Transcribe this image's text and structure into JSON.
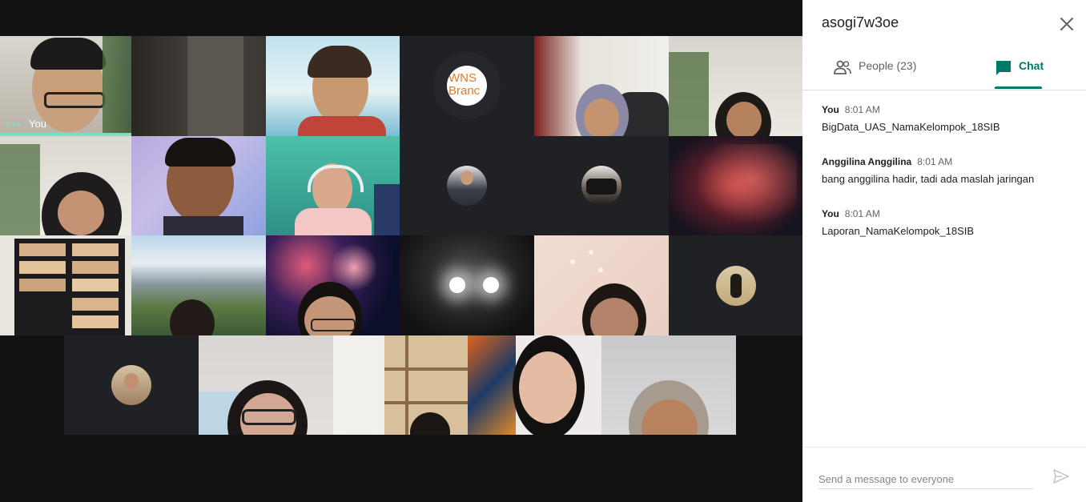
{
  "meeting": {
    "code": "asogi7w3oe",
    "self_label": "You",
    "tiles_row3_banner": "WNS Branc"
  },
  "panel": {
    "tabs": [
      {
        "label": "People (23)",
        "icon": "people-icon"
      },
      {
        "label": "Chat",
        "icon": "chat-icon",
        "active": true
      }
    ],
    "messages": [
      {
        "sender": "You",
        "time": "8:01 AM",
        "text": "BigData_UAS_NamaKelompok_18SIB"
      },
      {
        "sender": "Anggilina Anggilina",
        "time": "8:01 AM",
        "text": "bang anggilina hadir, tadi ada maslah jaringan"
      },
      {
        "sender": "You",
        "time": "8:01 AM",
        "text": "Laporan_NamaKelompok_18SIB"
      }
    ],
    "composer": {
      "placeholder": "Send a message to everyone"
    }
  },
  "colors": {
    "accent": "#00796b",
    "speaking": "#7fdcc4",
    "stage_bg": "#121212",
    "tile_bg": "#202124"
  }
}
